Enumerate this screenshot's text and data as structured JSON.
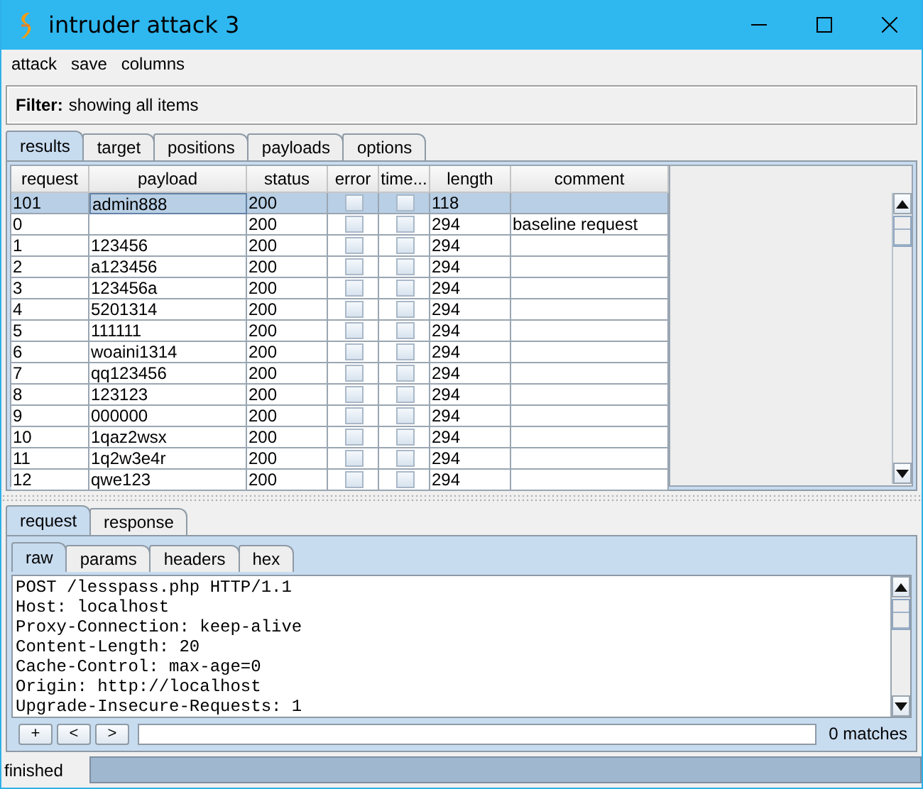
{
  "window": {
    "title": "intruder attack 3"
  },
  "menu": [
    "attack",
    "save",
    "columns"
  ],
  "filter": {
    "label": "Filter:",
    "text": "showing all items"
  },
  "tabs": [
    {
      "label": "results",
      "selected": true
    },
    {
      "label": "target",
      "selected": false
    },
    {
      "label": "positions",
      "selected": false
    },
    {
      "label": "payloads",
      "selected": false
    },
    {
      "label": "options",
      "selected": false
    }
  ],
  "table": {
    "columns": [
      "request",
      "payload",
      "status",
      "error",
      "time...",
      "length",
      "comment"
    ],
    "rows": [
      {
        "request": "101",
        "payload": "admin888",
        "status": "200",
        "error": false,
        "timeout": false,
        "length": "118",
        "comment": "",
        "selected": true
      },
      {
        "request": "0",
        "payload": "",
        "status": "200",
        "error": false,
        "timeout": false,
        "length": "294",
        "comment": "baseline request",
        "selected": false
      },
      {
        "request": "1",
        "payload": "123456",
        "status": "200",
        "error": false,
        "timeout": false,
        "length": "294",
        "comment": "",
        "selected": false
      },
      {
        "request": "2",
        "payload": "a123456",
        "status": "200",
        "error": false,
        "timeout": false,
        "length": "294",
        "comment": "",
        "selected": false
      },
      {
        "request": "3",
        "payload": "123456a",
        "status": "200",
        "error": false,
        "timeout": false,
        "length": "294",
        "comment": "",
        "selected": false
      },
      {
        "request": "4",
        "payload": "5201314",
        "status": "200",
        "error": false,
        "timeout": false,
        "length": "294",
        "comment": "",
        "selected": false
      },
      {
        "request": "5",
        "payload": "111111",
        "status": "200",
        "error": false,
        "timeout": false,
        "length": "294",
        "comment": "",
        "selected": false
      },
      {
        "request": "6",
        "payload": "woaini1314",
        "status": "200",
        "error": false,
        "timeout": false,
        "length": "294",
        "comment": "",
        "selected": false
      },
      {
        "request": "7",
        "payload": "qq123456",
        "status": "200",
        "error": false,
        "timeout": false,
        "length": "294",
        "comment": "",
        "selected": false
      },
      {
        "request": "8",
        "payload": "123123",
        "status": "200",
        "error": false,
        "timeout": false,
        "length": "294",
        "comment": "",
        "selected": false
      },
      {
        "request": "9",
        "payload": "000000",
        "status": "200",
        "error": false,
        "timeout": false,
        "length": "294",
        "comment": "",
        "selected": false
      },
      {
        "request": "10",
        "payload": "1qaz2wsx",
        "status": "200",
        "error": false,
        "timeout": false,
        "length": "294",
        "comment": "",
        "selected": false
      },
      {
        "request": "11",
        "payload": "1q2w3e4r",
        "status": "200",
        "error": false,
        "timeout": false,
        "length": "294",
        "comment": "",
        "selected": false
      },
      {
        "request": "12",
        "payload": "qwe123",
        "status": "200",
        "error": false,
        "timeout": false,
        "length": "294",
        "comment": "",
        "selected": false
      }
    ]
  },
  "message_tabs": [
    {
      "label": "request",
      "selected": true
    },
    {
      "label": "response",
      "selected": false
    }
  ],
  "view_tabs": [
    {
      "label": "raw",
      "selected": true
    },
    {
      "label": "params",
      "selected": false
    },
    {
      "label": "headers",
      "selected": false
    },
    {
      "label": "hex",
      "selected": false
    }
  ],
  "message_lines": [
    "POST /lesspass.php HTTP/1.1",
    "Host: localhost",
    "Proxy-Connection: keep-alive",
    "Content-Length: 20",
    "Cache-Control: max-age=0",
    "Origin: http://localhost",
    "Upgrade-Insecure-Requests: 1"
  ],
  "search": {
    "buttons": [
      "+",
      "<",
      ">"
    ],
    "matches": "0 matches"
  },
  "status_bar": {
    "text": "finished",
    "level": 1
  }
}
